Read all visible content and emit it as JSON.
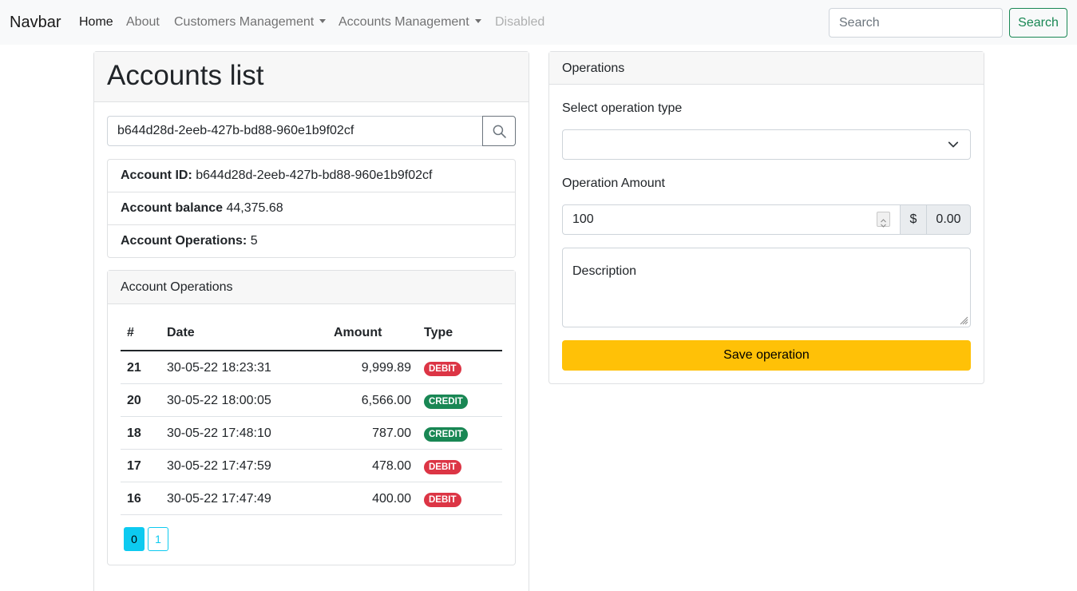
{
  "navbar": {
    "brand": "Navbar",
    "links": [
      {
        "label": "Home"
      },
      {
        "label": "About"
      },
      {
        "label": "Customers Management"
      },
      {
        "label": "Accounts Management"
      },
      {
        "label": "Disabled"
      }
    ],
    "search_placeholder": "Search",
    "search_button": "Search"
  },
  "accounts": {
    "title": "Accounts list",
    "search_value": "b644d28d-2eeb-427b-bd88-960e1b9f02cf",
    "info": {
      "id_label": "Account ID:",
      "id_value": "b644d28d-2eeb-427b-bd88-960e1b9f02cf",
      "balance_label": "Account balance",
      "balance_value": "44,375.68",
      "ops_label": "Account Operations:",
      "ops_value": "5"
    },
    "operations": {
      "title": "Account Operations",
      "columns": [
        "#",
        "Date",
        "Amount",
        "Type"
      ],
      "rows": [
        {
          "id": "21",
          "date": "30-05-22 18:23:31",
          "amount": "9,999.89",
          "type": "DEBIT"
        },
        {
          "id": "20",
          "date": "30-05-22 18:00:05",
          "amount": "6,566.00",
          "type": "CREDIT"
        },
        {
          "id": "18",
          "date": "30-05-22 17:48:10",
          "amount": "787.00",
          "type": "CREDIT"
        },
        {
          "id": "17",
          "date": "30-05-22 17:47:59",
          "amount": "478.00",
          "type": "DEBIT"
        },
        {
          "id": "16",
          "date": "30-05-22 17:47:49",
          "amount": "400.00",
          "type": "DEBIT"
        }
      ],
      "pages": [
        "0",
        "1"
      ]
    }
  },
  "operations_form": {
    "title": "Operations",
    "type_label": "Select operation type",
    "type_value": "",
    "amount_label": "Operation Amount",
    "amount_value": "100",
    "currency": "$",
    "amount_display": "0.00",
    "description_placeholder": "Description",
    "save_button": "Save operation"
  },
  "colors": {
    "debit": "#dc3545",
    "credit": "#198754",
    "page_active": "#0dcaf0",
    "save": "#ffc107",
    "nav_search_button": "#198754"
  }
}
